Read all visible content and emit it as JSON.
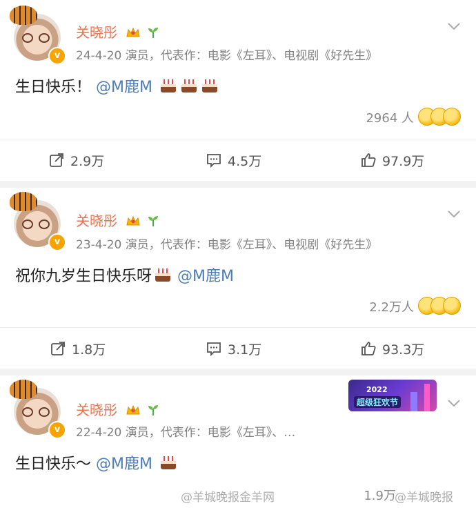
{
  "posts": [
    {
      "author": "关晓彤",
      "meta": "24-4-20  演员，代表作：电影《左耳》、电视剧《好先生》",
      "text": "生日快乐！",
      "mention": "@M鹿M",
      "cakes": 3,
      "likers": "2964 人",
      "repost": "2.9万",
      "comment": "4.5万",
      "like": "97.9万"
    },
    {
      "author": "关晓彤",
      "meta": "23-4-20  演员，代表作：电影《左耳》、电视剧《好先生》",
      "text": "祝你九岁生日快乐呀",
      "mention": "@M鹿M",
      "cakes": 1,
      "likers": "2.2万人",
      "repost": "1.8万",
      "comment": "3.1万",
      "like": "93.3万"
    },
    {
      "author": "关晓彤",
      "meta": "22-4-20  演员，代表作：电影《左耳》、…",
      "text": "生日快乐～",
      "mention": "@M鹿M",
      "cakes": 1,
      "likers": "1.9万",
      "banner_year": "2022",
      "banner_text": "超级狂欢节"
    }
  ],
  "watermark_left": "@羊城晚报金羊网",
  "watermark_right": "@羊城晚报",
  "icons": [
    "chevron-down-icon",
    "crown-icon",
    "sprout-icon",
    "verified-icon",
    "cake-icon",
    "repost-icon",
    "comment-icon",
    "like-icon"
  ],
  "colors": {
    "name": "#eb7350",
    "mention": "#4d7db5",
    "divider": "#f2f2f2",
    "verified": "#f7a400"
  }
}
